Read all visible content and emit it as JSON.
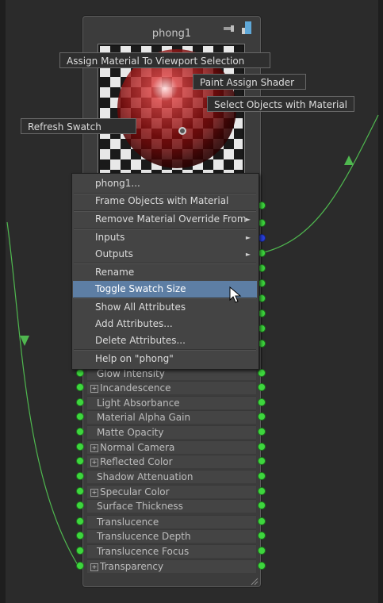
{
  "node": {
    "title": "phong1",
    "icons": [
      "connection-icon",
      "output-node-icon"
    ]
  },
  "tooltips": {
    "assign_material": "Assign Material To Viewport Selection",
    "paint_assign": "Paint Assign Shader",
    "select_objects": "Select Objects with Material",
    "refresh_swatch": "Refresh Swatch"
  },
  "context_menu": {
    "items": [
      {
        "label": "phong1..."
      },
      {
        "label": "Frame Objects with Material"
      },
      {
        "label": "Remove Material Override From",
        "submenu": true
      },
      {
        "label": "Inputs",
        "submenu": true
      },
      {
        "label": "Outputs",
        "submenu": true
      },
      {
        "label": "Rename"
      },
      {
        "label": "Toggle Swatch Size",
        "highlighted": true
      },
      {
        "label": "Show All Attributes"
      },
      {
        "label": "Add Attributes..."
      },
      {
        "label": "Delete Attributes..."
      },
      {
        "label": "Help on \"phong\""
      }
    ]
  },
  "attributes": [
    {
      "label": "Glow Intensity",
      "expandable": false
    },
    {
      "label": "Incandescence",
      "expandable": true
    },
    {
      "label": "Light Absorbance",
      "expandable": false
    },
    {
      "label": "Material Alpha Gain",
      "expandable": false
    },
    {
      "label": "Matte Opacity",
      "expandable": false
    },
    {
      "label": "Normal Camera",
      "expandable": true
    },
    {
      "label": "Reflected Color",
      "expandable": true
    },
    {
      "label": "Shadow Attenuation",
      "expandable": false
    },
    {
      "label": "Specular Color",
      "expandable": true
    },
    {
      "label": "Surface Thickness",
      "expandable": false
    },
    {
      "label": "Translucence",
      "expandable": false
    },
    {
      "label": "Translucence Depth",
      "expandable": false
    },
    {
      "label": "Translucence Focus",
      "expandable": false
    },
    {
      "label": "Transparency",
      "expandable": true
    }
  ],
  "colors": {
    "port_green": "#3ed63e",
    "port_blue": "#2840e0",
    "wire": "#4fb84f",
    "menu_highlight": "#5d7ea4"
  }
}
